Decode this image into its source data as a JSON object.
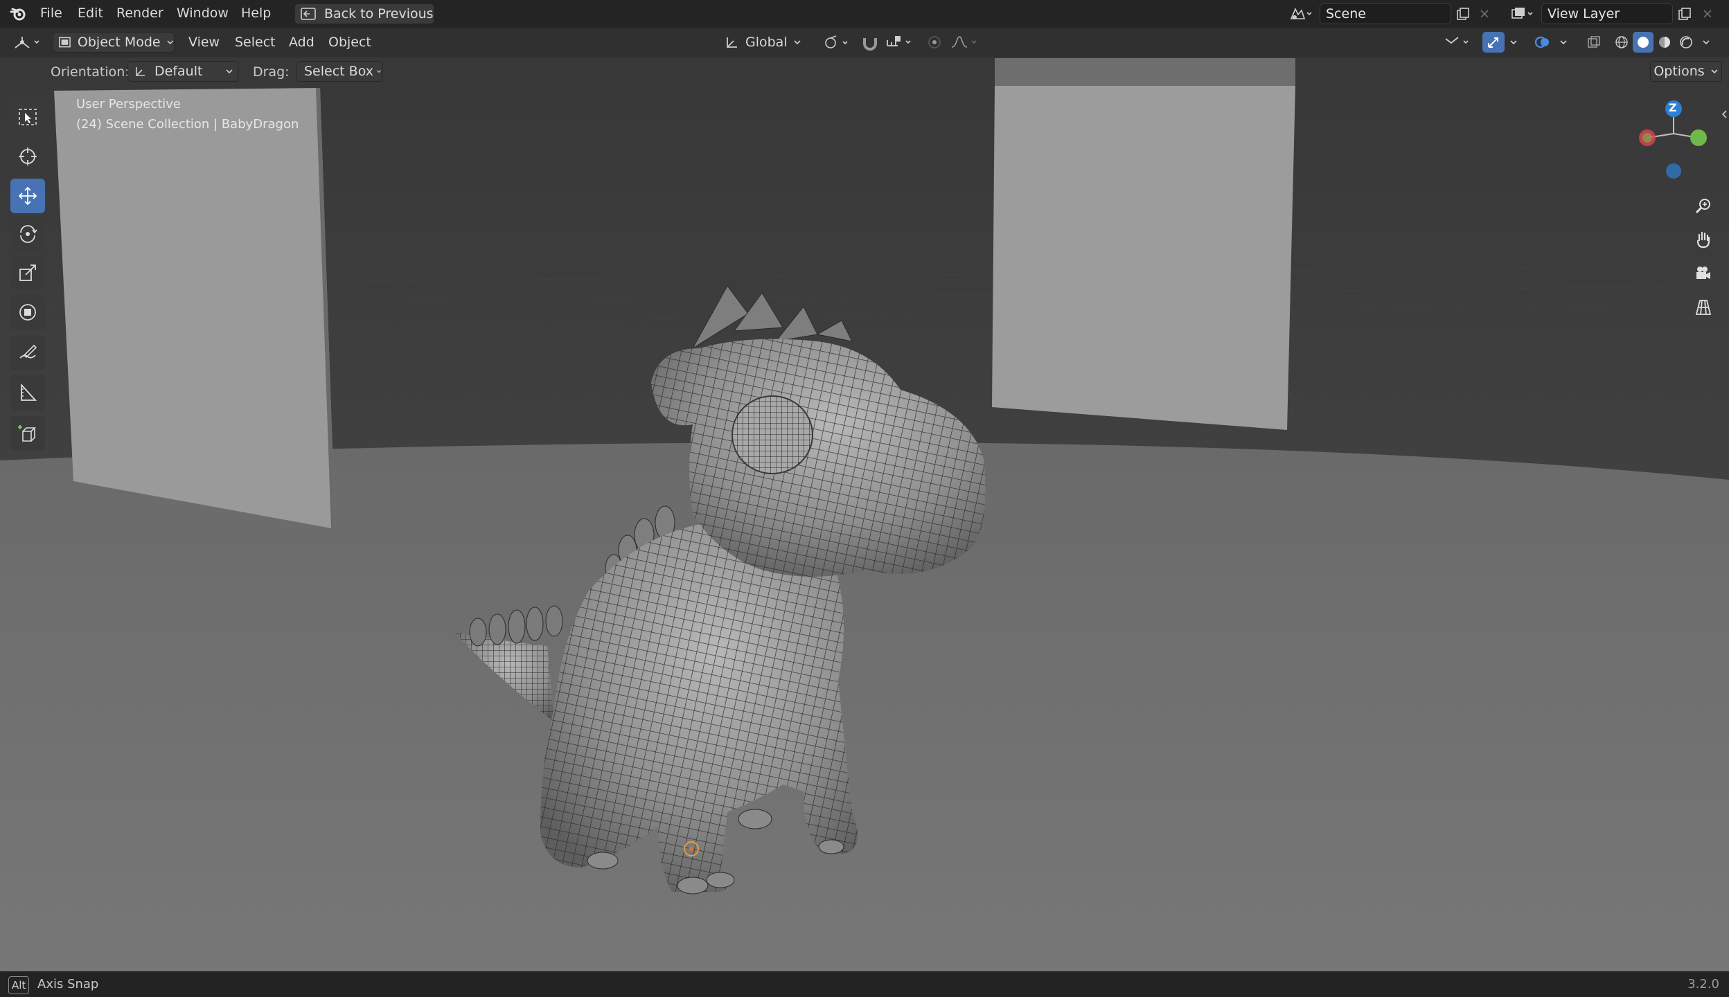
{
  "menubar": {
    "items": [
      "File",
      "Edit",
      "Render",
      "Window",
      "Help"
    ],
    "back_button": "Back to Previous",
    "scene": {
      "label": "Scene"
    },
    "view_layer": {
      "label": "View Layer"
    }
  },
  "header": {
    "mode": "Object Mode",
    "menus": [
      "View",
      "Select",
      "Add",
      "Object"
    ],
    "transform_orientation": "Global",
    "options_label": "Options"
  },
  "tool_settings": {
    "orientation_label": "Orientation:",
    "orientation_value": "Default",
    "drag_label": "Drag:",
    "drag_value": "Select Box"
  },
  "viewport": {
    "overlay_line1": "User Perspective",
    "overlay_line2": "(24) Scene Collection | BabyDragon"
  },
  "gizmo": {
    "z_label": "Z"
  },
  "toolbar": {
    "tools": [
      "select-box",
      "cursor",
      "move",
      "rotate",
      "scale",
      "transform",
      "annotate",
      "measure",
      "add-cube"
    ],
    "active": "move"
  },
  "status": {
    "key": "Alt",
    "hint": "Axis Snap",
    "version": "3.2.0"
  },
  "colors": {
    "accent": "#4772b3",
    "gizmo_x": "#d8434f",
    "gizmo_y": "#6fb94b",
    "gizmo_z": "#2f7fd6"
  }
}
